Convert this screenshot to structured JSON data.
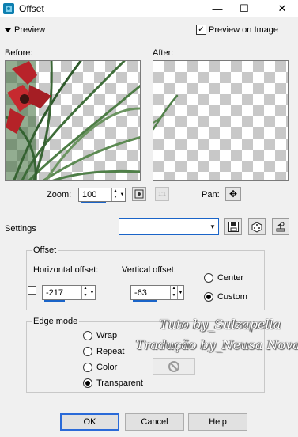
{
  "window": {
    "title": "Offset",
    "minimize": "—",
    "maximize": "☐",
    "close": "✕"
  },
  "preview": {
    "toggle_label": "Preview",
    "preview_on_image_label": "Preview on Image",
    "preview_on_image_checked": true,
    "before_label": "Before:",
    "after_label": "After:",
    "zoom_label": "Zoom:",
    "zoom_value": "100",
    "pan_label": "Pan:"
  },
  "settings": {
    "label": "Settings",
    "preset_value": ""
  },
  "offset": {
    "group_title": "Offset",
    "horizontal_label": "Horizontal offset:",
    "horizontal_value": "-217",
    "vertical_label": "Vertical offset:",
    "vertical_value": "-63",
    "mode_options": [
      "Center",
      "Custom"
    ],
    "mode_selected": "Custom"
  },
  "edge_mode": {
    "group_title": "Edge mode",
    "options": [
      "Wrap",
      "Repeat",
      "Color",
      "Transparent"
    ],
    "selected": "Transparent"
  },
  "buttons": {
    "ok": "OK",
    "cancel": "Cancel",
    "help": "Help"
  },
  "watermark": {
    "line1": "Tuto by_Sulzapella",
    "line2": "Tradução by_Neusa Nova"
  },
  "colors": {
    "accent": "#1a64c8",
    "flower": "#b8232a",
    "leaves": "#3c6e3a"
  }
}
